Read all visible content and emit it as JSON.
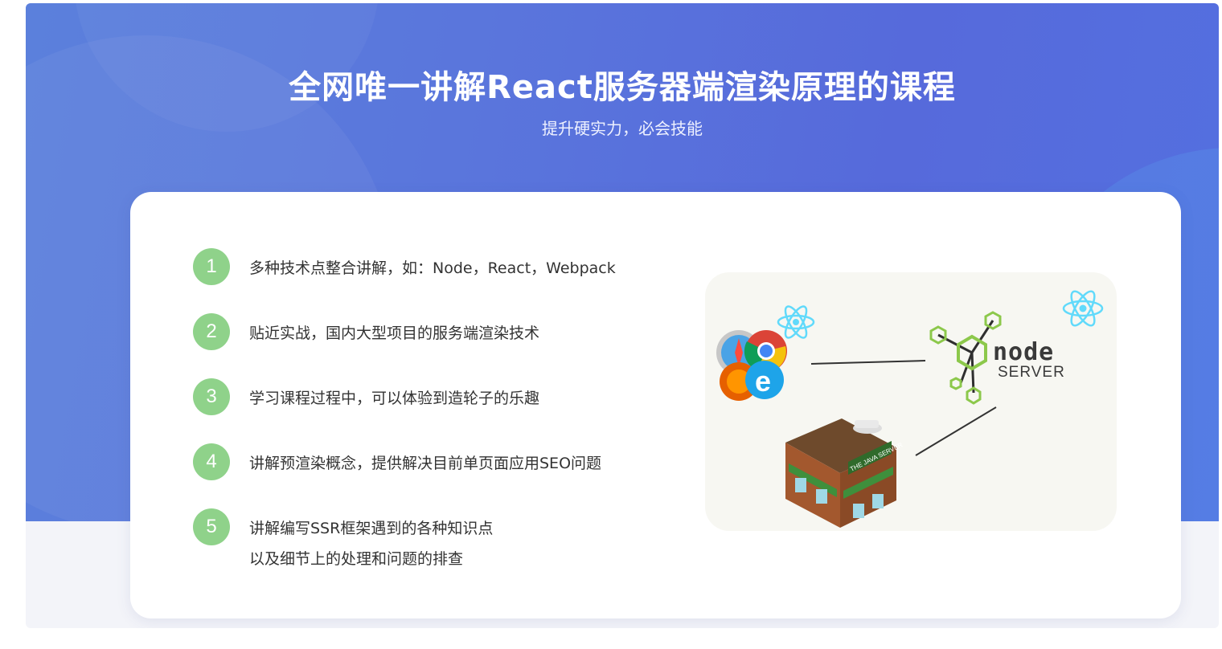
{
  "header": {
    "title": "全网唯一讲解React服务器端渲染原理的课程",
    "subtitle": "提升硬实力，必会技能"
  },
  "features": [
    {
      "number": "1",
      "lines": [
        "多种技术点整合讲解，如：Node，React，Webpack"
      ]
    },
    {
      "number": "2",
      "lines": [
        "贴近实战，国内大型项目的服务端渲染技术"
      ]
    },
    {
      "number": "3",
      "lines": [
        "学习课程过程中，可以体验到造轮子的乐趣"
      ]
    },
    {
      "number": "4",
      "lines": [
        "讲解预渲染概念，提供解决目前单页面应用SEO问题"
      ]
    },
    {
      "number": "5",
      "lines": [
        "讲解编写SSR框架遇到的各种知识点",
        "以及细节上的处理和问题的排查"
      ]
    }
  ],
  "illustration": {
    "node_logo_text": "node",
    "server_text": "SERVER",
    "building_sign_text": "THE JAVA SERVER",
    "icons": [
      "react-icon",
      "browsers-icon",
      "node-hexagon-icon",
      "java-server-building-icon"
    ]
  },
  "colors": {
    "banner_blue": "#5a76dc",
    "number_badge": "#8fd28a",
    "text": "#333333",
    "react_cyan": "#61dafb",
    "node_green": "#8cc84b"
  }
}
